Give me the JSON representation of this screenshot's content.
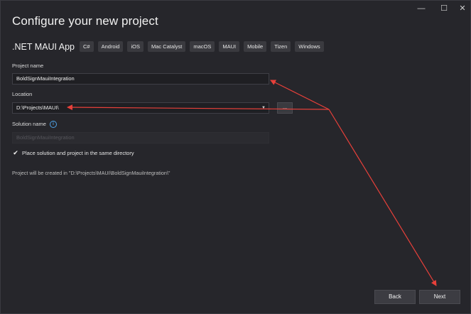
{
  "window": {
    "minimize_icon": "minimize-icon",
    "maximize_icon": "maximize-icon",
    "close_icon": "close-icon"
  },
  "header": {
    "title": "Configure your new project",
    "template_name": ".NET MAUI App",
    "tags": [
      "C#",
      "Android",
      "iOS",
      "Mac Catalyst",
      "macOS",
      "MAUI",
      "Mobile",
      "Tizen",
      "Windows"
    ]
  },
  "form": {
    "project_name_label": "Project name",
    "project_name_value": "BoldSignMauiIntegration",
    "location_label": "Location",
    "location_value": "D:\\Projects\\MAUI\\",
    "browse_label": "...",
    "solution_name_label": "Solution name",
    "solution_name_value": "BoldSignMauiIntegration",
    "same_directory_label": "Place solution and project in the same directory",
    "same_directory_checked": true,
    "path_info": "Project will be created in \"D:\\Projects\\MAUI\\BoldSignMauiIntegration\\\""
  },
  "footer": {
    "back_label": "Back",
    "next_label": "Next"
  },
  "annotation": {
    "arrow_color": "#e8403a"
  }
}
